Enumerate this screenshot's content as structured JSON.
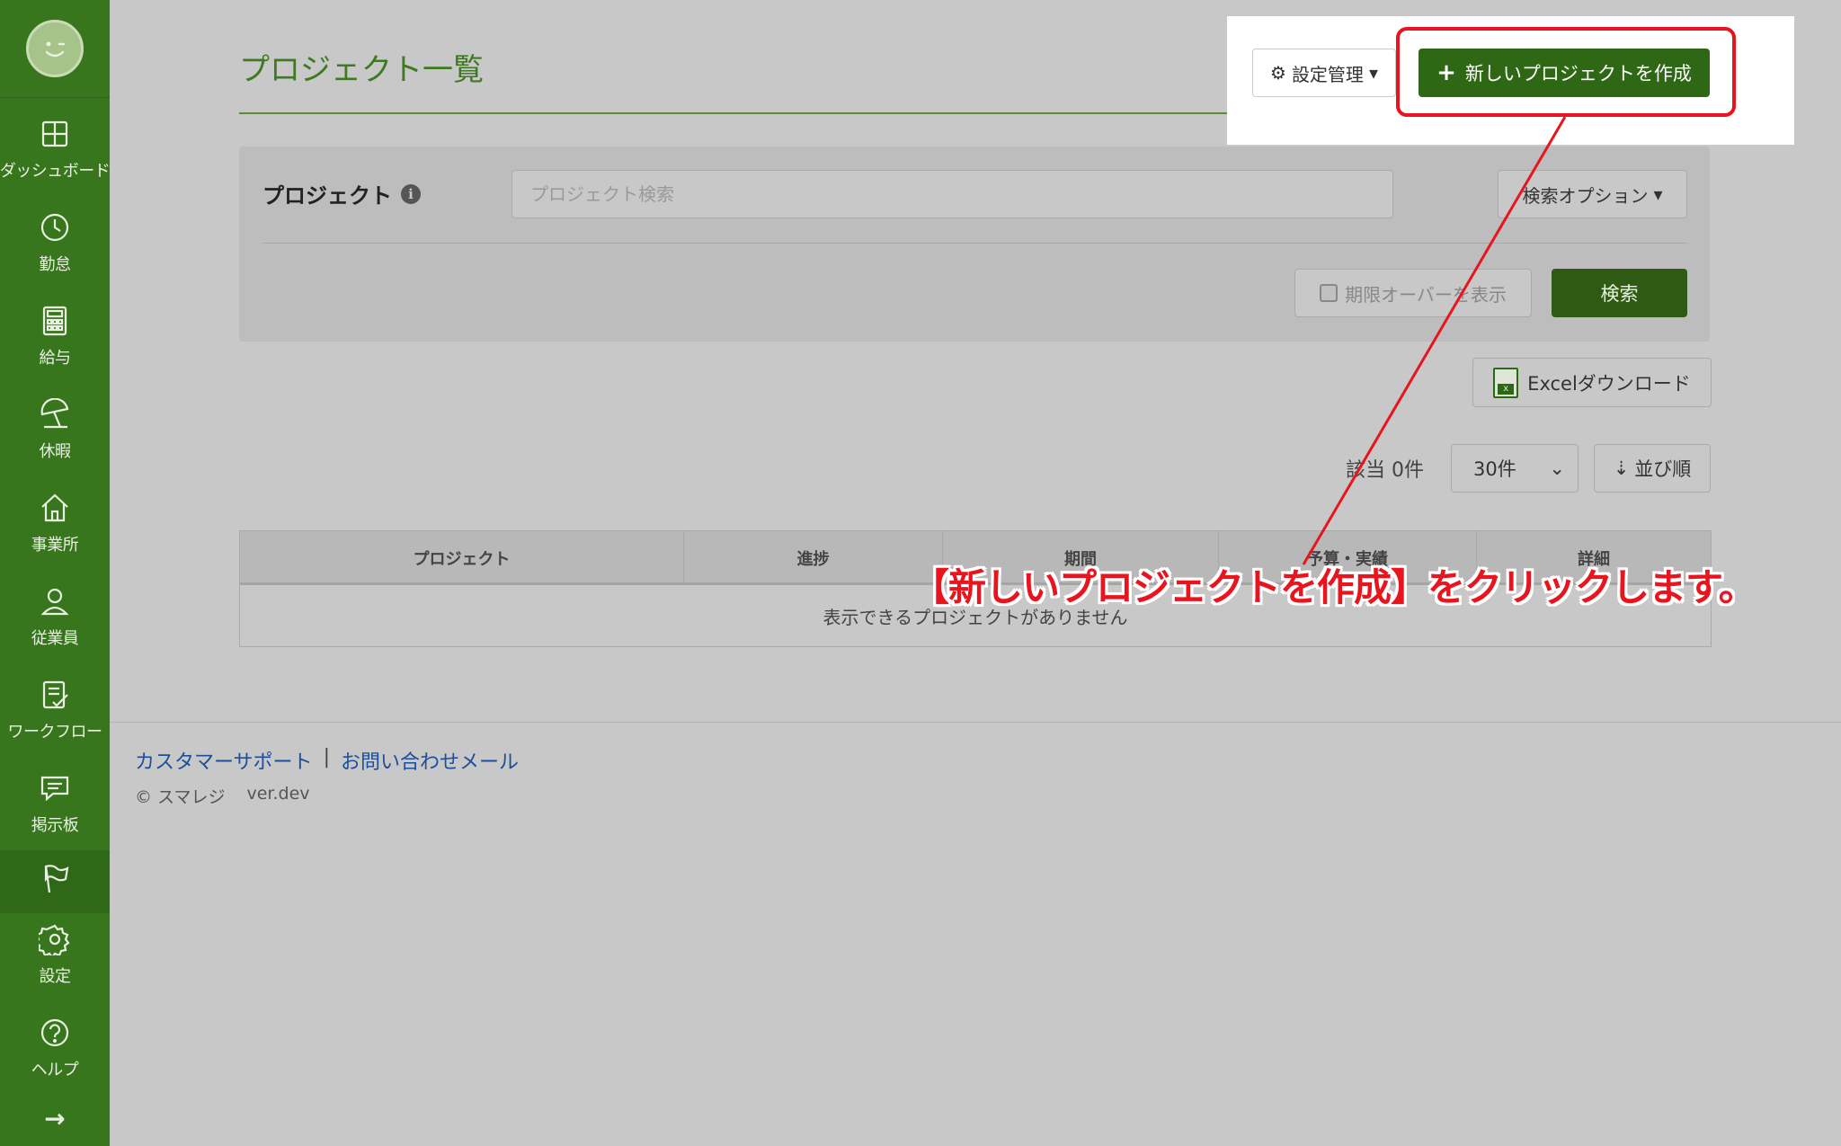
{
  "sidebar": {
    "items": [
      {
        "label": "ダッシュボード",
        "icon": "dashboard-icon"
      },
      {
        "label": "勤怠",
        "icon": "clock-icon"
      },
      {
        "label": "給与",
        "icon": "calculator-icon"
      },
      {
        "label": "休暇",
        "icon": "beach-umbrella-icon"
      },
      {
        "label": "事業所",
        "icon": "home-icon"
      },
      {
        "label": "従業員",
        "icon": "person-icon"
      },
      {
        "label": "ワークフロー",
        "icon": "checklist-icon"
      },
      {
        "label": "掲示板",
        "icon": "message-icon"
      },
      {
        "label": "",
        "icon": "flag-icon",
        "active": true
      },
      {
        "label": "設定",
        "icon": "gear-icon"
      },
      {
        "label": "ヘルプ",
        "icon": "help-icon"
      }
    ],
    "expand_arrow": "→"
  },
  "header": {
    "title": "プロジェクト一覧",
    "settings_label": "設定管理",
    "new_project_label": "新しいプロジェクトを作成"
  },
  "search": {
    "label": "プロジェクト",
    "placeholder": "プロジェクト検索",
    "options_label": "検索オプション",
    "overdue_label": "期限オーバーを表示",
    "search_button": "検索"
  },
  "excel": {
    "label": "Excelダウンロード"
  },
  "results": {
    "count_label": "該当 0件",
    "per_page": "30件",
    "sort_label": "並び順"
  },
  "table": {
    "headers": [
      "プロジェクト",
      "進捗",
      "期間",
      "予算・実績",
      "詳細"
    ],
    "empty_message": "表示できるプロジェクトがありません"
  },
  "footer": {
    "support_link": "カスタマーサポート",
    "separator": "|",
    "contact_link": "お問い合わせメール",
    "copyright": "© スマレジ",
    "version": "ver.dev"
  },
  "annotation": {
    "text": "【新しいプロジェクトを作成】をクリックします。",
    "color": "#e8141e"
  },
  "colors": {
    "sidebar_bg": "#38761d",
    "primary_button": "#2f6814",
    "title_color": "#3d7a20",
    "link_color": "#1d4e99"
  }
}
